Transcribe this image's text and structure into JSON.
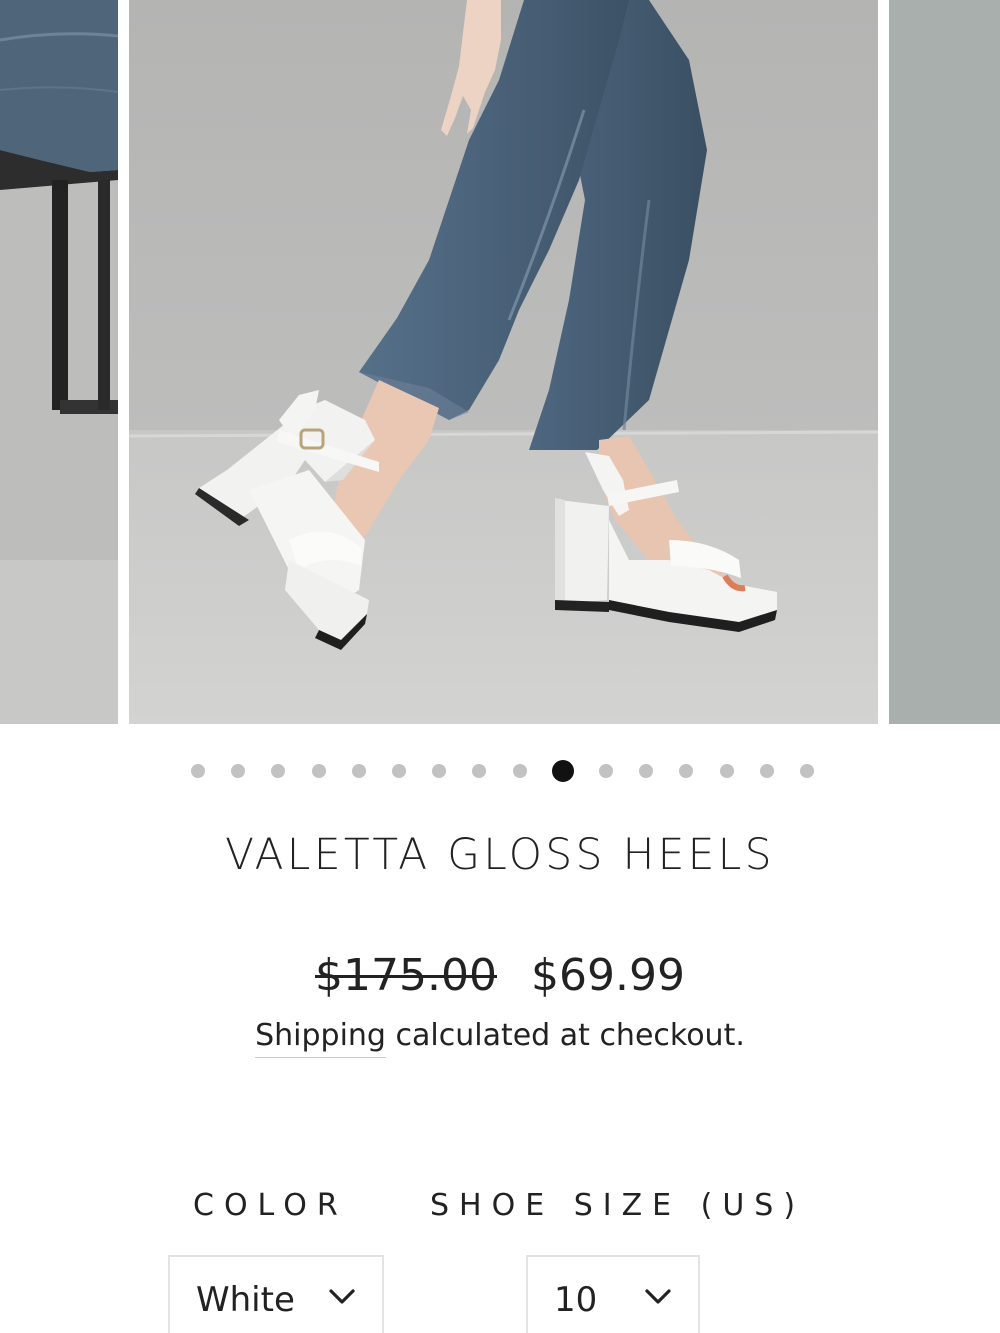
{
  "carousel": {
    "slide_count": 16,
    "active_index": 9,
    "main_image_alt": "white gloss platform heels with blue jeans"
  },
  "product": {
    "title": "VALETTA GLOSS HEELS",
    "compare_at_price": "$175.00",
    "price": "$69.99",
    "shipping_link": "Shipping",
    "shipping_rest": " calculated at checkout."
  },
  "options": {
    "color_label": "COLOR",
    "color_value": "White",
    "size_label": "SHOE SIZE (US)",
    "size_value": "10"
  },
  "icons": {
    "dropdown": "chevron-down-icon"
  },
  "colors": {
    "text": "#222222",
    "dot_inactive": "#c2c2c2",
    "dot_active": "#111111",
    "backdrop": "#b7b7b5",
    "denim": "#4d6378",
    "shoe": "#f4f4f2"
  }
}
